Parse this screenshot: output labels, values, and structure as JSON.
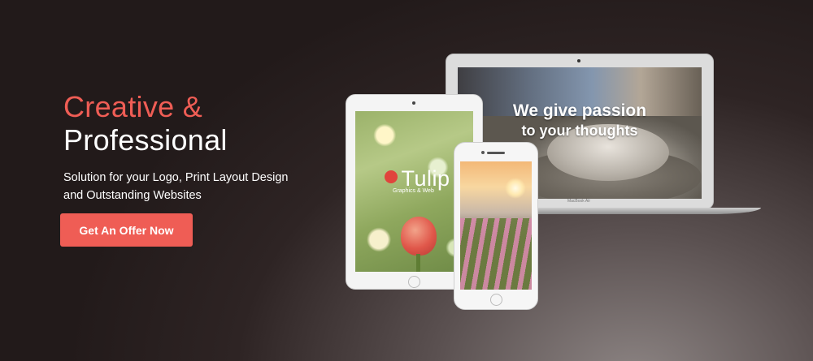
{
  "hero": {
    "headline_accent": "Creative &",
    "headline_main": "Professional",
    "subtitle": "Solution for your Logo, Print Layout Design and Outstanding Websites",
    "cta_label": "Get An Offer Now"
  },
  "devices": {
    "laptop_tagline_line1": "We give passion",
    "laptop_tagline_line2": "to your thoughts",
    "laptop_brand": "MacBook Air",
    "tablet_brand_name": "Tulip",
    "tablet_brand_sub": "Graphics & Web"
  },
  "colors": {
    "accent": "#ef5d55",
    "text": "#ffffff"
  }
}
